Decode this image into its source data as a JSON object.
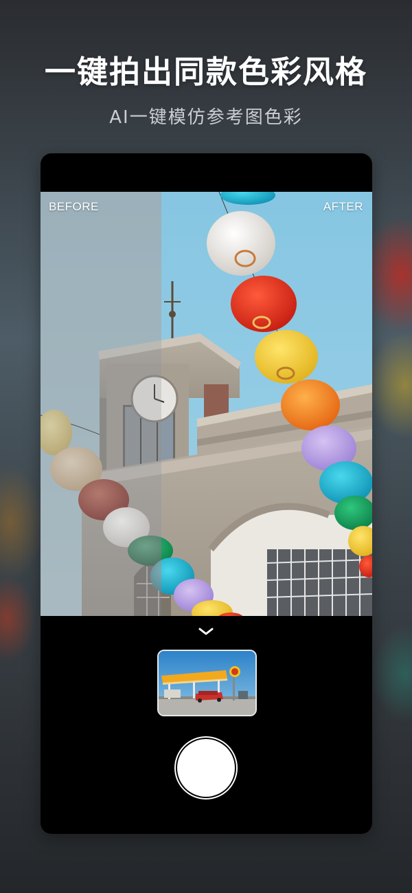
{
  "headline": "一键拍出同款色彩风格",
  "subheadline": "AI一键模仿参考图色彩",
  "preview": {
    "before_label": "BEFORE",
    "after_label": "AFTER"
  },
  "icons": {
    "expand": "chevron-down-icon",
    "shutter": "shutter-button"
  },
  "colors": {
    "sky_after": "#7fc3e0",
    "sky_before": "#a9b1b6",
    "phone_bg": "#000000"
  }
}
